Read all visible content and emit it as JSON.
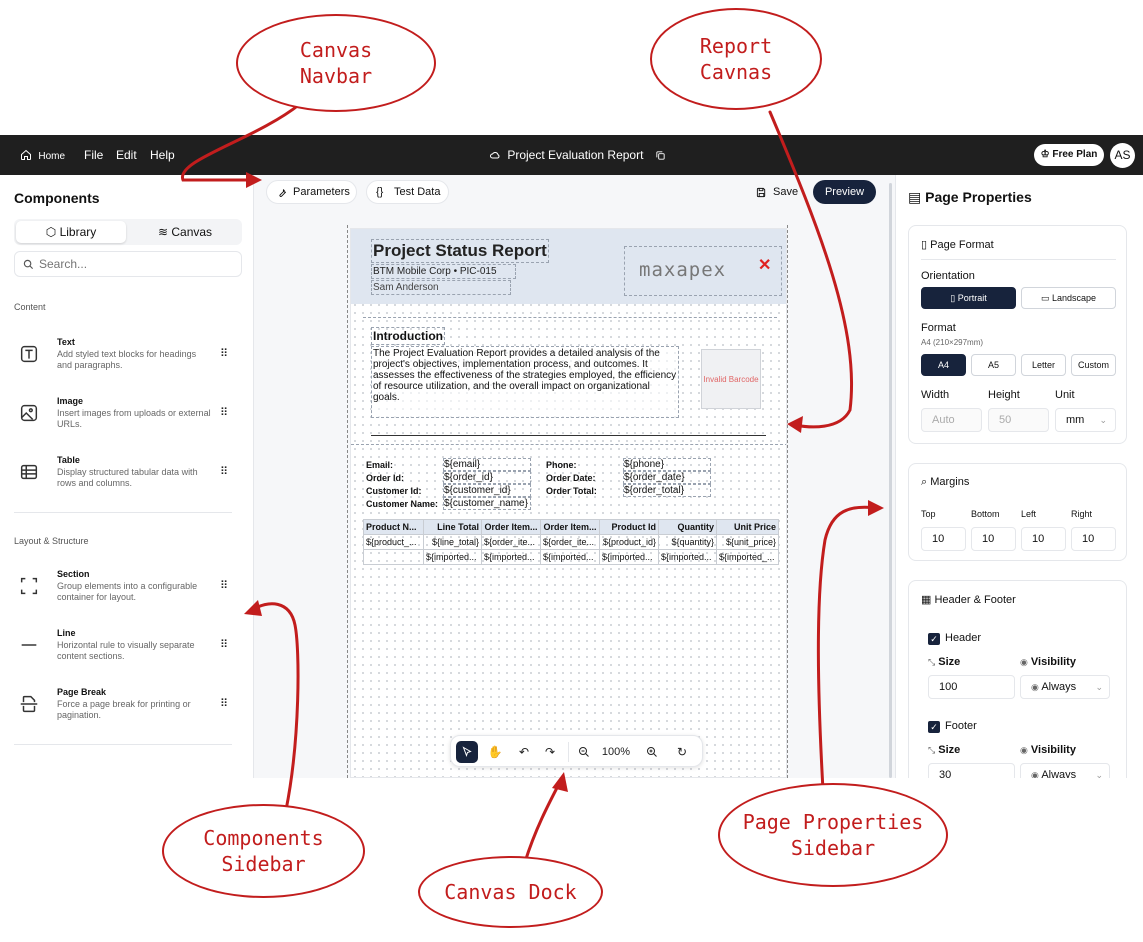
{
  "topbar": {
    "home": "Home",
    "menu": [
      "File",
      "Edit",
      "Help"
    ],
    "doc_title": "Project Evaluation Report",
    "plan_label": "Free Plan",
    "avatar": "AS"
  },
  "components_sidebar": {
    "title": "Components",
    "tabs": [
      "Library",
      "Canvas"
    ],
    "search_placeholder": "Search...",
    "content_label": "Content",
    "layout_label": "Layout & Structure",
    "items": [
      {
        "name": "Text",
        "desc": "Add styled text blocks for headings and paragraphs."
      },
      {
        "name": "Image",
        "desc": "Insert images from uploads or external URLs."
      },
      {
        "name": "Table",
        "desc": "Display structured tabular data with rows and columns."
      },
      {
        "name": "Section",
        "desc": "Group elements into a configurable container for layout."
      },
      {
        "name": "Line",
        "desc": "Horizontal rule to visually separate content sections."
      },
      {
        "name": "Page Break",
        "desc": "Force a page break for printing or pagination."
      }
    ]
  },
  "canvas_nav": {
    "parameters": "Parameters",
    "test_data": "Test Data",
    "save": "Save",
    "preview": "Preview"
  },
  "report": {
    "title": "Project Status Report",
    "company": "BTM Mobile Corp • PIC-015",
    "author": "Sam Anderson",
    "logo": "maxapex",
    "intro_title": "Introduction",
    "intro_text": "The Project Evaluation Report provides a detailed analysis of the project's objectives, implementation process, and outcomes. It assesses the effectiveness of the strategies employed, the efficiency of resource utilization, and the overall impact on organizational goals.",
    "barcode": "Invalid Barcode",
    "fields_left": [
      {
        "label": "Email:",
        "value": "${email}"
      },
      {
        "label": "Order Id:",
        "value": "${order_id}"
      },
      {
        "label": "Customer Id:",
        "value": "${customer_id}"
      },
      {
        "label": "Customer Name:",
        "value": "${customer_name}"
      }
    ],
    "fields_right": [
      {
        "label": "Phone:",
        "value": "${phone}"
      },
      {
        "label": "Order Date:",
        "value": "${order_date}"
      },
      {
        "label": "Order Total:",
        "value": "${order_total}"
      }
    ],
    "table": {
      "headers": [
        "Product N...",
        "Line Total",
        "Order Item...",
        "Order Item...",
        "Product Id",
        "Quantity",
        "Unit Price"
      ],
      "rows": [
        [
          "${product_...",
          "${line_total}",
          "${order_ite...",
          "${order_ite...",
          "${product_id}",
          "${quantity}",
          "${unit_price}"
        ],
        [
          "",
          "${imported...",
          "${imported...",
          "${imported...",
          "${imported...",
          "${imported...",
          "${imported_..."
        ]
      ]
    }
  },
  "dock": {
    "zoom": "100%"
  },
  "page_properties": {
    "title": "Page Properties",
    "format_card": {
      "title": "Page Format",
      "orientation_label": "Orientation",
      "orientations": [
        "Portrait",
        "Landscape"
      ],
      "format_label": "Format",
      "format_sub": "A4 (210×297mm)",
      "formats": [
        "A4",
        "A5",
        "Letter",
        "Custom"
      ],
      "width_label": "Width",
      "height_label": "Height",
      "unit_label": "Unit",
      "width_value": "Auto",
      "height_value": "50",
      "unit_value": "mm"
    },
    "margins_card": {
      "title": "Margins",
      "labels": [
        "Top",
        "Bottom",
        "Left",
        "Right"
      ],
      "values": [
        "10",
        "10",
        "10",
        "10"
      ]
    },
    "hf_card": {
      "title": "Header & Footer",
      "header_label": "Header",
      "footer_label": "Footer",
      "size_label": "Size",
      "visibility_label": "Visibility",
      "header_size": "100",
      "footer_size": "30",
      "visibility_value": "Always"
    }
  },
  "annotations": {
    "canvas_navbar": "Canvas\nNavbar",
    "report_canvas": "Report\nCavnas",
    "components_sidebar": "Components\nSidebar",
    "canvas_dock": "Canvas Dock",
    "page_properties_sidebar": "Page Properties\nSidebar",
    "color": "#c21d1d"
  }
}
